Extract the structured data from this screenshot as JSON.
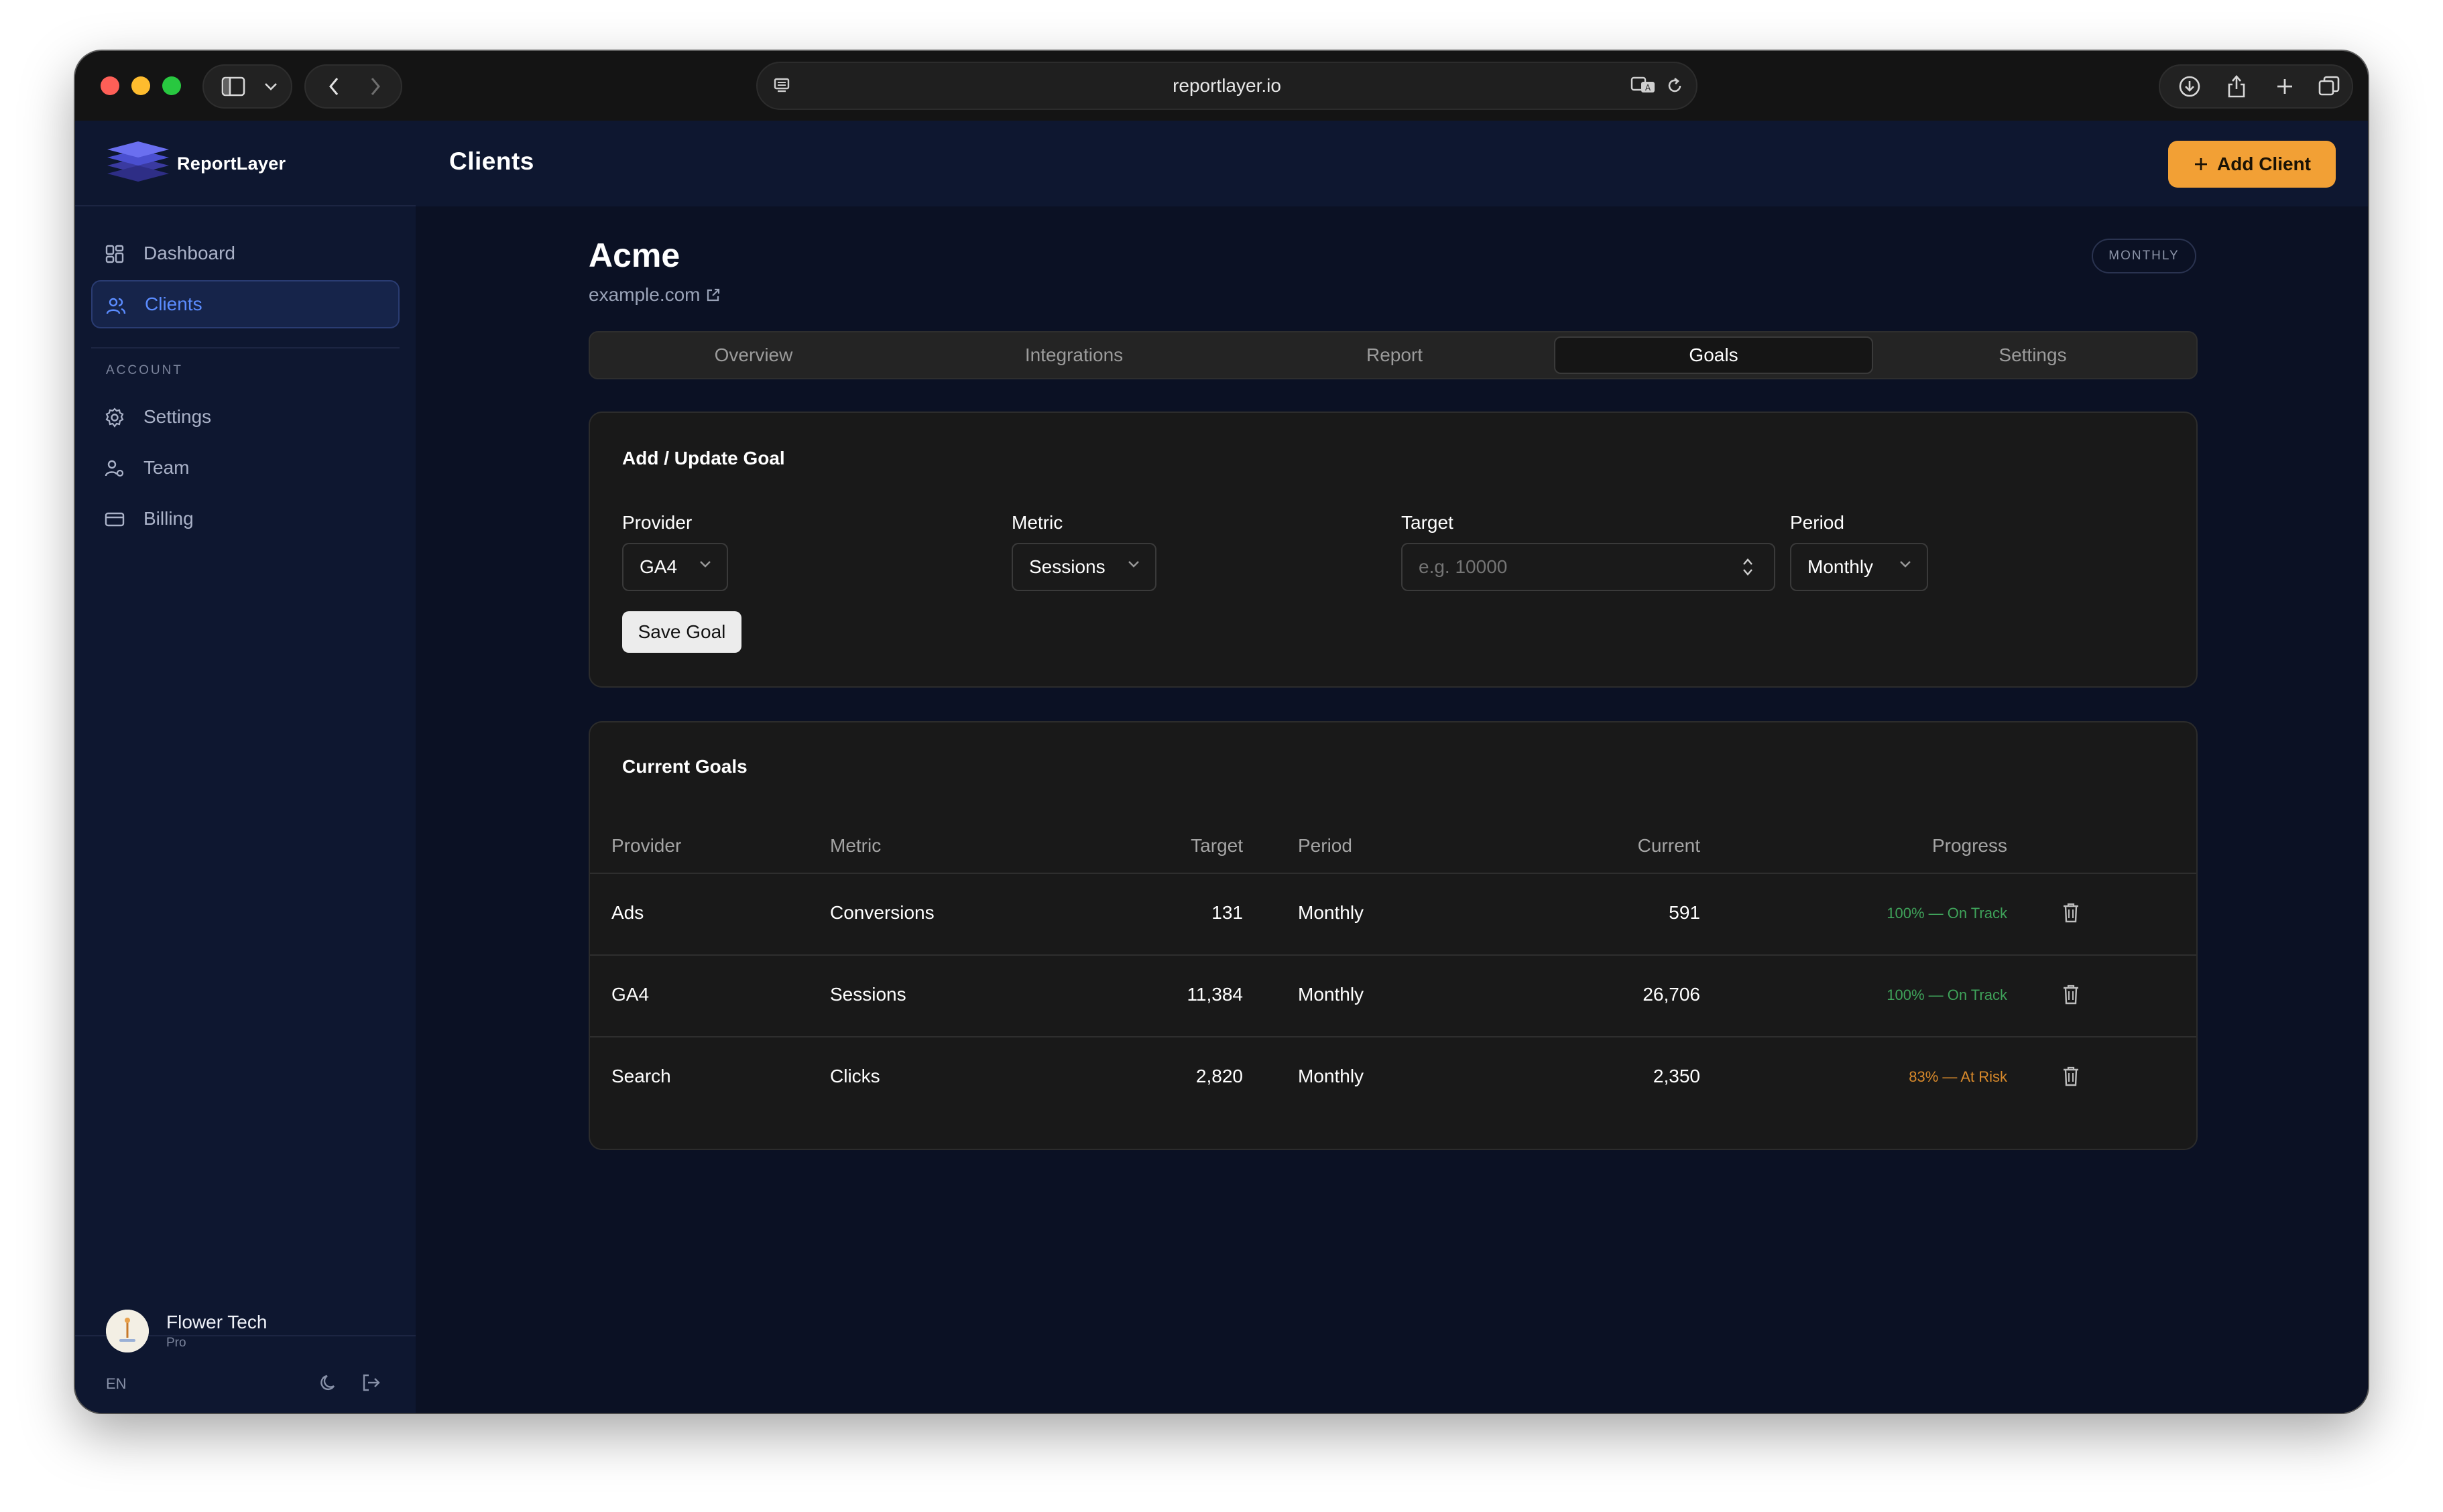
{
  "browser": {
    "url": "reportlayer.io"
  },
  "sidebar": {
    "brand": "ReportLayer",
    "nav": [
      {
        "label": "Dashboard",
        "icon": "dashboard-icon"
      },
      {
        "label": "Clients",
        "icon": "users-icon",
        "active": true
      }
    ],
    "account_label": "ACCOUNT",
    "account_items": [
      {
        "label": "Settings",
        "icon": "gear-icon"
      },
      {
        "label": "Team",
        "icon": "team-icon"
      },
      {
        "label": "Billing",
        "icon": "card-icon"
      }
    ],
    "user": {
      "name": "Flower Tech",
      "plan": "Pro"
    },
    "language": "EN"
  },
  "header": {
    "title": "Clients",
    "add_button": "Add Client"
  },
  "client": {
    "name": "Acme",
    "url": "example.com",
    "period_badge": "MONTHLY"
  },
  "tabs": [
    {
      "label": "Overview"
    },
    {
      "label": "Integrations"
    },
    {
      "label": "Report"
    },
    {
      "label": "Goals",
      "active": true
    },
    {
      "label": "Settings"
    }
  ],
  "goal_form": {
    "title": "Add / Update Goal",
    "provider_label": "Provider",
    "provider_value": "GA4",
    "metric_label": "Metric",
    "metric_value": "Sessions",
    "target_label": "Target",
    "target_placeholder": "e.g. 10000",
    "period_label": "Period",
    "period_value": "Monthly",
    "save_label": "Save Goal"
  },
  "goals": {
    "title": "Current Goals",
    "columns": [
      "Provider",
      "Metric",
      "Target",
      "Period",
      "Current",
      "Progress"
    ],
    "rows": [
      {
        "provider": "Ads",
        "metric": "Conversions",
        "target": "131",
        "period": "Monthly",
        "current": "591",
        "progress": "100% — On Track",
        "status": "on-track"
      },
      {
        "provider": "GA4",
        "metric": "Sessions",
        "target": "11,384",
        "period": "Monthly",
        "current": "26,706",
        "progress": "100% — On Track",
        "status": "on-track"
      },
      {
        "provider": "Search",
        "metric": "Clicks",
        "target": "2,820",
        "period": "Monthly",
        "current": "2,350",
        "progress": "83% — At Risk",
        "status": "at-risk"
      }
    ]
  },
  "colors": {
    "accent": "#f2a035",
    "active_nav": "#5b8cff",
    "on_track": "#3fa35a",
    "at_risk": "#d98a2b",
    "background": "#0b1124",
    "sidebar": "#0e1730"
  }
}
